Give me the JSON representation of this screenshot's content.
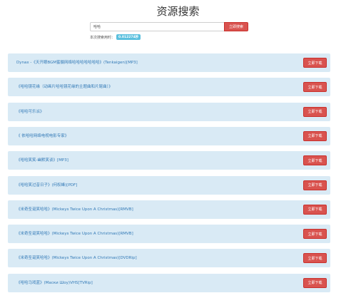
{
  "header": {
    "title": "资源搜索"
  },
  "search": {
    "value": "哈哈",
    "button_label": "立即搜索"
  },
  "stats": {
    "label": "本次搜索用时：",
    "time": "0.012274秒"
  },
  "results": [
    {
      "title": "Dynax -《天开眼BGM蜜摄网络哈哈哈哈哈哈哈》(Tenkaigen)[MP3]",
      "download_label": "立即下载"
    },
    {
      "title": "《哈哈镜花缘（动画片哈哈镜花缘的主题曲和片尾曲）》",
      "download_label": "立即下载"
    },
    {
      "title": "《哈哈可乐派》",
      "download_label": "立即下载"
    },
    {
      "title": "《 依哈哈网络电视电影专家》",
      "download_label": "立即下载"
    },
    {
      "title": "《哈哈笑笑-幽默笑谈》[MP3]",
      "download_label": "立即下载"
    },
    {
      "title": "《哈哈笑过昔日子》(何权峰)[PDF]",
      "download_label": "立即下载"
    },
    {
      "title": "《米奇圣诞笑哈哈》(Mickeys Twice Upon A Christmas)[RMVB]",
      "download_label": "立即下载"
    },
    {
      "title": "《米奇圣诞笑哈哈》(Mickeys Twice Upon A Christmas)[RMVB]",
      "download_label": "立即下载"
    },
    {
      "title": "《米奇圣诞笑哈哈》(Mickeys Twice Upon A Christmas)[DVDRip]",
      "download_label": "立即下载"
    },
    {
      "title": "《哈哈马戏蓝》(Маски Шоу)VHS[TVRip]",
      "download_label": "立即下载"
    }
  ]
}
